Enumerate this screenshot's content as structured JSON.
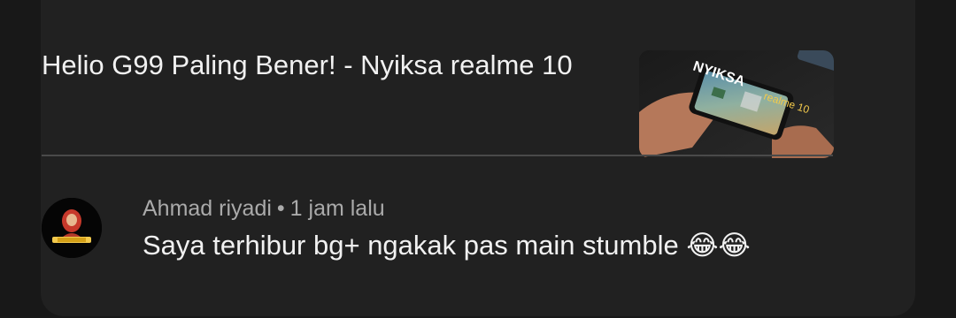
{
  "video": {
    "title": "Helio G99 Paling Bener! - Nyiksa realme 10",
    "thumbnail_text_top": "NYIKSA",
    "thumbnail_text_bottom": "realme 10"
  },
  "comment": {
    "author": "Ahmad riyadi",
    "separator": "•",
    "time": "1 jam lalu",
    "text": "Saya terhibur bg+ ngakak pas main stumble 😂😂"
  },
  "colors": {
    "background": "#181818",
    "card": "#212121",
    "primary_text": "#f1f1f1",
    "secondary_text": "#aaaaaa",
    "divider": "#4a4a4a",
    "thumbnail_accent": "#f2c94c"
  }
}
